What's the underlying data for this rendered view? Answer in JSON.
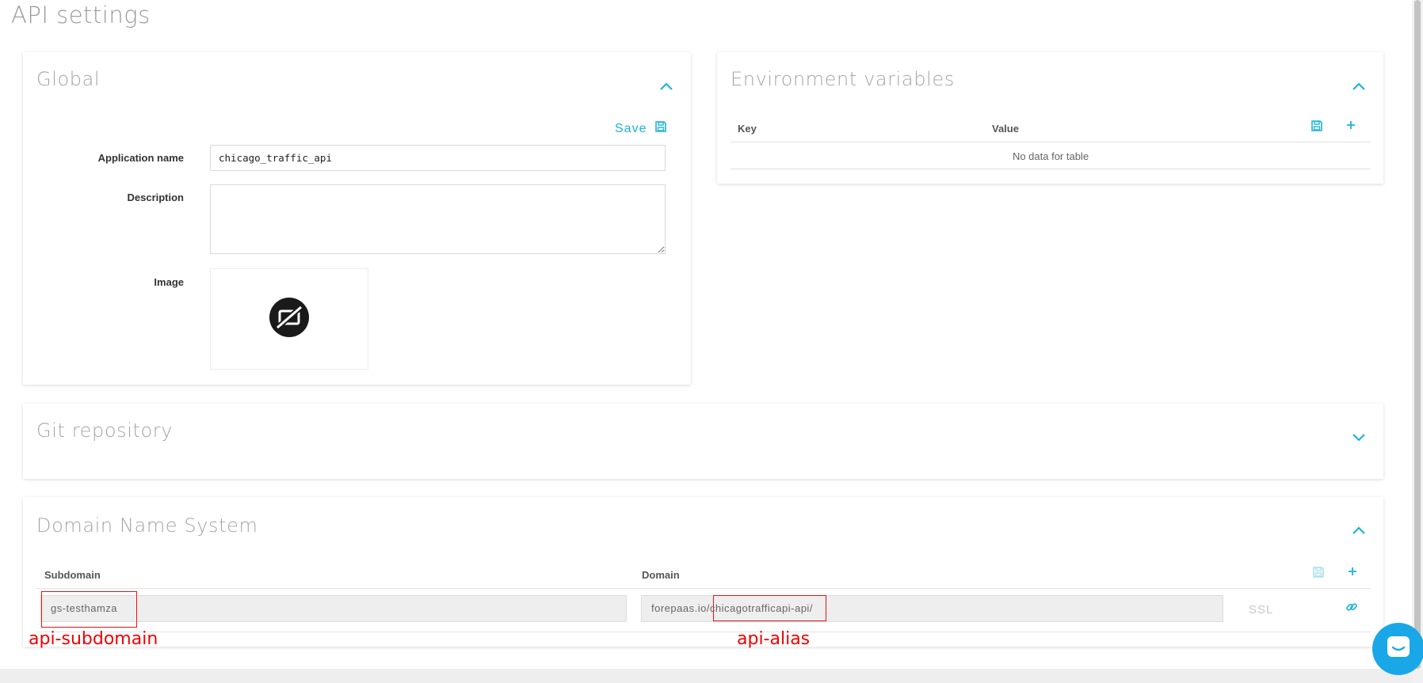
{
  "page": {
    "title": "API settings"
  },
  "global": {
    "title": "Global",
    "save_label": "Save",
    "app_name_label": "Application name",
    "app_name_value": "chicago_traffic_api",
    "description_label": "Description",
    "description_value": "",
    "image_label": "Image"
  },
  "env": {
    "title": "Environment variables",
    "columns": [
      "Key",
      "Value"
    ],
    "empty_message": "No data for table"
  },
  "git": {
    "title": "Git repository"
  },
  "dns": {
    "title": "Domain Name System",
    "columns": [
      "Subdomain",
      "Domain"
    ],
    "subdomain_value": "gs-testhamza",
    "domain_value": "forepaas.io/chicagotrafficapi-api/",
    "ssl_label": "SSL"
  },
  "annotations": {
    "subdomain_label": "api-subdomain",
    "alias_label": "api-alias"
  },
  "colors": {
    "accent": "#1fb3d7",
    "annotation": "#e00000",
    "chat": "#1aa7e8"
  },
  "icons": [
    "chevron-up-icon",
    "chevron-down-icon",
    "save-icon",
    "plus-icon",
    "no-image-icon",
    "link-icon",
    "chat-icon"
  ]
}
